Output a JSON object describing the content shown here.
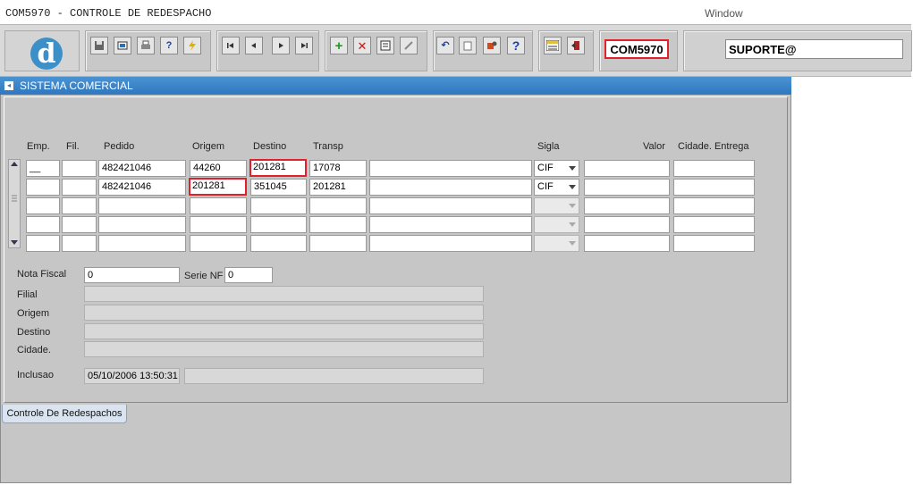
{
  "window": {
    "title": "COM5970 - CONTROLE DE REDESPACHO",
    "menu": "Window"
  },
  "toolbar": {
    "form_code": "COM5970",
    "user": "SUPORTE@",
    "logo_letter": "d"
  },
  "panel": {
    "title": "SISTEMA COMERCIAL",
    "tab_label": "Controle De Redespachos"
  },
  "grid": {
    "headers": {
      "emp": "Emp.",
      "fil": "Fil.",
      "pedido": "Pedido",
      "origem": "Origem",
      "destino": "Destino",
      "transp": "Transp",
      "sigla": "Sigla",
      "valor": "Valor",
      "cidade": "Cidade. Entrega"
    },
    "rows": [
      {
        "emp": "__",
        "fil": "",
        "pedido": "482421046",
        "origem": "44260",
        "destino": "201281",
        "transp": "17078",
        "desc": "",
        "sigla": "CIF",
        "valor": "",
        "cidade": ""
      },
      {
        "emp": "",
        "fil": "",
        "pedido": "482421046",
        "origem": "201281",
        "destino": "351045",
        "transp": "201281",
        "desc": "",
        "sigla": "CIF",
        "valor": "",
        "cidade": ""
      },
      {
        "emp": "",
        "fil": "",
        "pedido": "",
        "origem": "",
        "destino": "",
        "transp": "",
        "desc": "",
        "sigla": "",
        "valor": "",
        "cidade": ""
      },
      {
        "emp": "",
        "fil": "",
        "pedido": "",
        "origem": "",
        "destino": "",
        "transp": "",
        "desc": "",
        "sigla": "",
        "valor": "",
        "cidade": ""
      },
      {
        "emp": "",
        "fil": "",
        "pedido": "",
        "origem": "",
        "destino": "",
        "transp": "",
        "desc": "",
        "sigla": "",
        "valor": "",
        "cidade": ""
      }
    ]
  },
  "details": {
    "nota_fiscal_label": "Nota Fiscal",
    "nota_fiscal": "0",
    "serie_label": "Serie NF",
    "serie": "0",
    "filial_label": "Filial",
    "origem_label": "Origem",
    "destino_label": "Destino",
    "cidade_label": "Cidade.",
    "inclusao_label": "Inclusao",
    "inclusao": "05/10/2006 13:50:31"
  }
}
